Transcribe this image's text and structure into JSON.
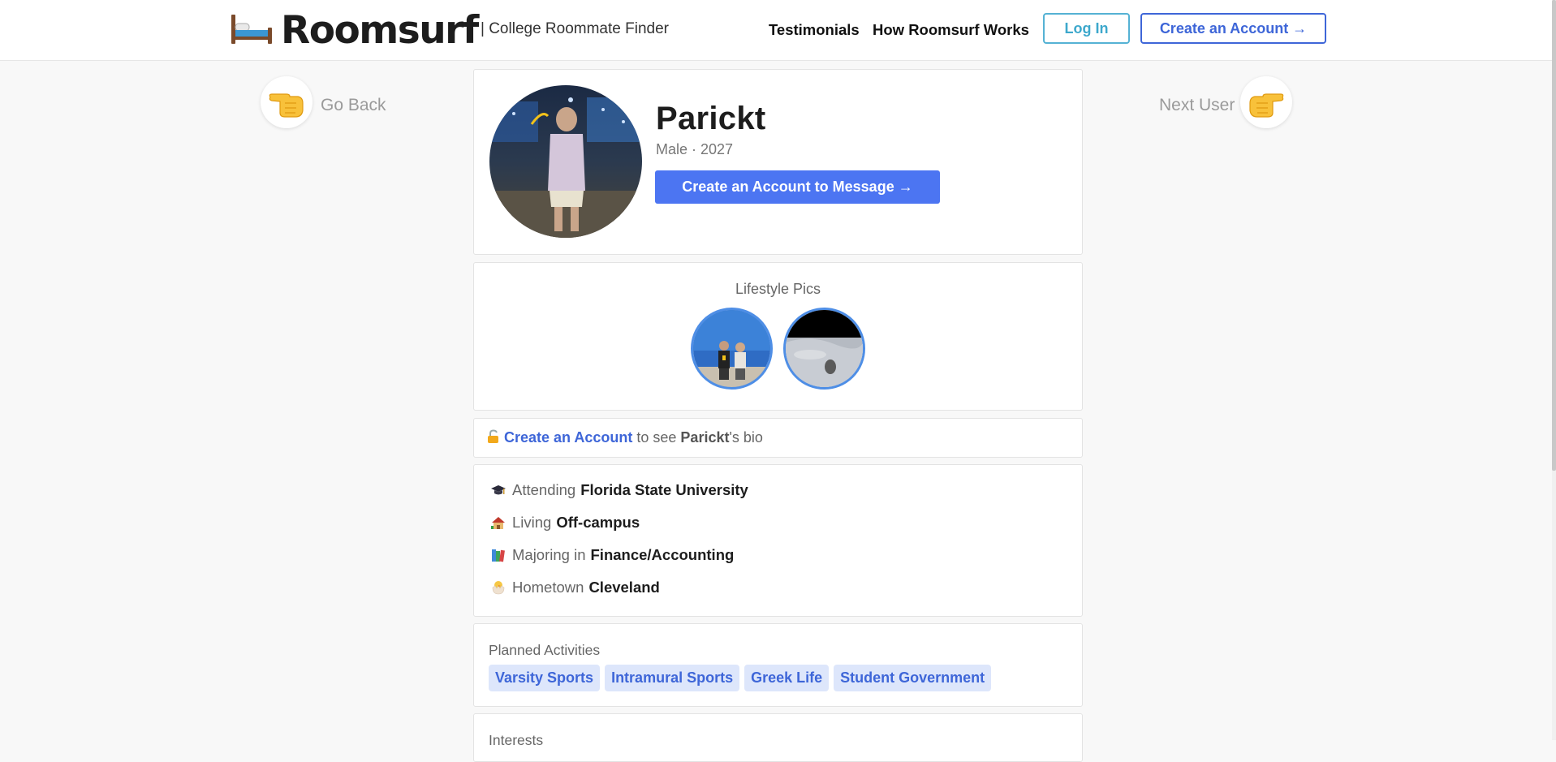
{
  "header": {
    "brand": "Roomsurf",
    "tagline": "| College Roommate Finder",
    "nav": {
      "testimonials": "Testimonials",
      "how_it_works": "How Roomsurf Works"
    },
    "login_label": "Log In",
    "create_account_label": "Create an Account →",
    "icons": {
      "logo": "bed-icon"
    }
  },
  "side_nav": {
    "back_label": "Go Back",
    "next_label": "Next User",
    "icons": {
      "back": "hand-pointing-left-icon",
      "next": "hand-pointing-right-icon"
    }
  },
  "profile": {
    "name": "Parickt",
    "meta": "Male · 2027",
    "message_button": "Create an Account to Message →"
  },
  "lifestyle": {
    "title": "Lifestyle Pics",
    "pics": [
      {
        "icon": "photo-friends"
      },
      {
        "icon": "photo-outdoor"
      }
    ]
  },
  "bio": {
    "link": "Create an Account",
    "text_before": " to see ",
    "name": "Parickt",
    "text_after": "'s bio",
    "icon": "lock-icon"
  },
  "info": {
    "items": [
      {
        "label": "Attending",
        "value": "Florida State University",
        "icon": "graduation-cap-icon"
      },
      {
        "label": "Living",
        "value": "Off-campus",
        "icon": "house-icon"
      },
      {
        "label": "Majoring in",
        "value": "Finance/Accounting",
        "icon": "books-icon"
      },
      {
        "label": "Hometown",
        "value": "Cleveland",
        "icon": "hatching-chick-icon"
      }
    ]
  },
  "activities": {
    "title": "Planned Activities",
    "tags": [
      "Varsity Sports",
      "Intramural Sports",
      "Greek Life",
      "Student Government"
    ]
  },
  "interests": {
    "title": "Interests"
  },
  "colors": {
    "accent": "#4c75f2",
    "link": "#3e66d8",
    "login": "#3da8cc",
    "tag_bg": "#dde6fb"
  }
}
